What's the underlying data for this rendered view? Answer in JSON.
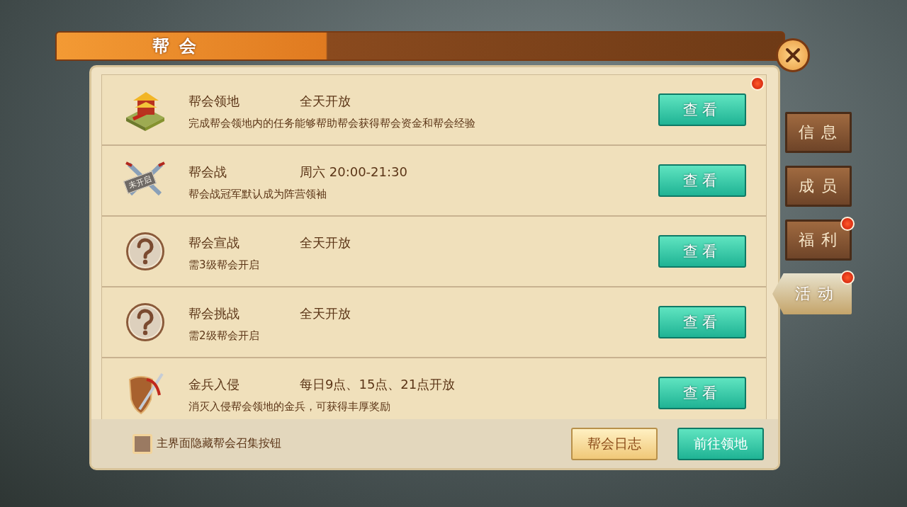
{
  "window": {
    "title": "帮会"
  },
  "activities": [
    {
      "kind": "building",
      "name": "帮会领地",
      "time": "全天开放",
      "desc": "完成帮会领地内的任务能够帮助帮会获得帮会资金和帮会经验",
      "button": "查看",
      "badge": true
    },
    {
      "kind": "swords",
      "icon_label": "未开启",
      "name": "帮会战",
      "time": "周六 20:00-21:30",
      "desc": "帮会战冠军默认成为阵营领袖",
      "button": "查看",
      "badge": false
    },
    {
      "kind": "question",
      "name": "帮会宣战",
      "time": "全天开放",
      "desc": "需3级帮会开启",
      "button": "查看",
      "badge": false
    },
    {
      "kind": "question",
      "name": "帮会挑战",
      "time": "全天开放",
      "desc": "需2级帮会开启",
      "button": "查看",
      "badge": false
    },
    {
      "kind": "shield",
      "name": "金兵入侵",
      "time": "每日9点、15点、21点开放",
      "desc": "消灭入侵帮会领地的金兵，可获得丰厚奖励",
      "button": "查看",
      "badge": false
    }
  ],
  "tabs": [
    {
      "label": "信息",
      "selected": false,
      "badge": false
    },
    {
      "label": "成员",
      "selected": false,
      "badge": false
    },
    {
      "label": "福利",
      "selected": false,
      "badge": true
    },
    {
      "label": "活动",
      "selected": true,
      "badge": true
    }
  ],
  "footer": {
    "checkbox": {
      "label": "主界面隐藏帮会召集按钮",
      "checked": false
    },
    "buttons": [
      {
        "label": "帮会日志",
        "kind": "gold"
      },
      {
        "label": "前往领地",
        "kind": "green"
      }
    ]
  }
}
